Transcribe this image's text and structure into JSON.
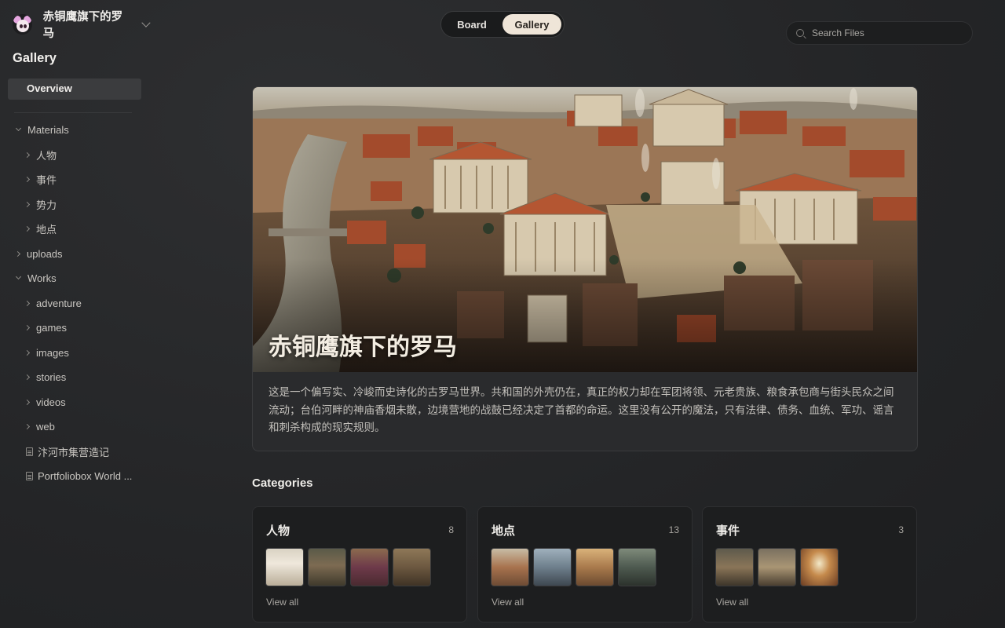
{
  "workspace": {
    "name": "赤铜鹰旗下的罗马"
  },
  "sidebar": {
    "title": "Gallery",
    "overview_label": "Overview",
    "tree": {
      "materials": "Materials",
      "people": "人物",
      "events": "事件",
      "factions": "势力",
      "places": "地点",
      "uploads": "uploads",
      "works": "Works",
      "adventure": "adventure",
      "games": "games",
      "images": "images",
      "stories": "stories",
      "videos": "videos",
      "web": "web",
      "file1": "汴河市集营造记",
      "file2": "Portfoliobox World ..."
    }
  },
  "view_toggle": {
    "board": "Board",
    "gallery": "Gallery",
    "selected": "Gallery"
  },
  "search": {
    "placeholder": "Search Files"
  },
  "hero": {
    "title": "赤铜鹰旗下的罗马",
    "description": "这是一个偏写实、冷峻而史诗化的古罗马世界。共和国的外壳仍在，真正的权力却在军团将领、元老贵族、粮食承包商与街头民众之间流动；台伯河畔的神庙香烟未散，边境营地的战鼓已经决定了首都的命运。这里没有公开的魔法，只有法律、债务、血统、军功、谣言和刺杀构成的现实规则。"
  },
  "categories": {
    "heading": "Categories",
    "items": [
      {
        "name": "人物",
        "count": "8",
        "view_all": "View all"
      },
      {
        "name": "地点",
        "count": "13",
        "view_all": "View all"
      },
      {
        "name": "事件",
        "count": "3",
        "view_all": "View all"
      }
    ]
  },
  "colors": {
    "accent_toggle": "#efe5d8",
    "background": "#28292b",
    "card": "#1d1e1f"
  },
  "icons": [
    "workspace-logo-icon",
    "chevron-down-icon",
    "chevron-right-icon",
    "file-icon",
    "search-icon"
  ]
}
